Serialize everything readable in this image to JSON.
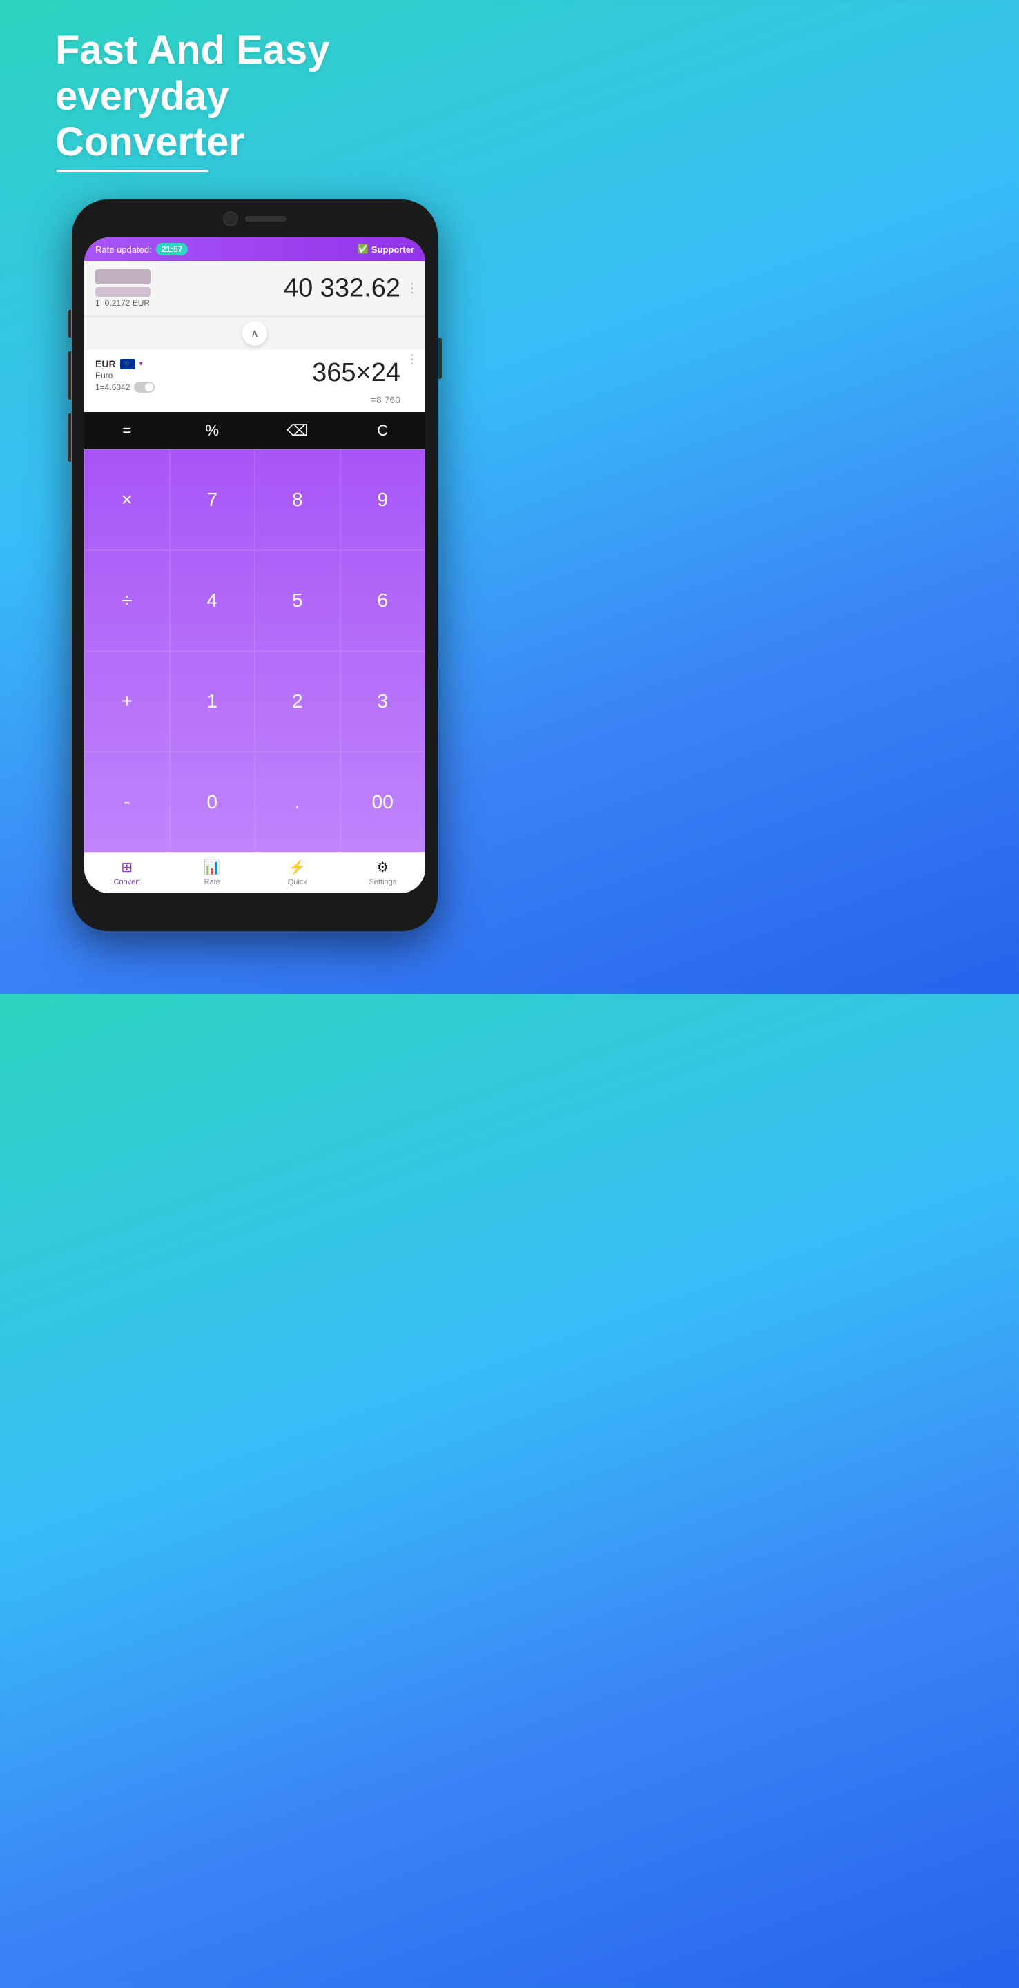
{
  "hero": {
    "line1": "Fast And Easy",
    "line2": "everyday",
    "line3": "Converter"
  },
  "statusBar": {
    "rateUpdatedLabel": "Rate updated:",
    "time": "21:57",
    "supporterLabel": "Supporter"
  },
  "currencyTop": {
    "rate": "1=0.2172 EUR",
    "amount": "40 332.62"
  },
  "currencyBottom": {
    "code": "EUR",
    "name": "Euro",
    "rate": "1=4.6042",
    "amount": "365×24",
    "result": "=8 760"
  },
  "keypad": {
    "ops": [
      "=",
      "%",
      "⌫",
      "C"
    ],
    "nums": [
      "×",
      "7",
      "8",
      "9",
      "÷",
      "4",
      "5",
      "6",
      "+",
      "1",
      "2",
      "3",
      "-",
      "0",
      ".",
      "00"
    ]
  },
  "bottomNav": [
    {
      "id": "convert",
      "label": "Convert",
      "active": true
    },
    {
      "id": "rate",
      "label": "Rate",
      "active": false
    },
    {
      "id": "quick",
      "label": "Quick",
      "active": false
    },
    {
      "id": "settings",
      "label": "Settings",
      "active": false
    }
  ]
}
